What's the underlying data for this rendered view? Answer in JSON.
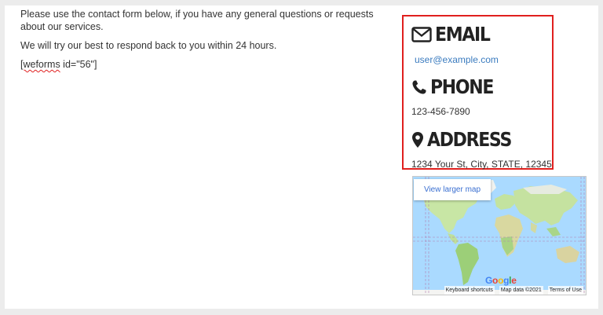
{
  "intro": {
    "line1": "Please use the contact form below, if you have any general questions or requests about our services.",
    "line2": "We will try our best to respond back to you within 24 hours.",
    "shortcode_word": "[weforms",
    "shortcode_rest": " id=\"56\"]"
  },
  "contact": {
    "email_title": "EMAIL",
    "email_value": "user@example.com",
    "phone_title": "PHONE",
    "phone_value": "123-456-7890",
    "address_title": "ADDRESS",
    "address_value": "1234 Your St, City, STATE, 12345",
    "highlight_color": "#e0201e"
  },
  "map": {
    "view_larger": "View larger map",
    "logo": "Google",
    "keyboard_shortcuts": "Keyboard shortcuts",
    "map_data": "Map data ©2021",
    "terms": "Terms of Use"
  },
  "icons": {
    "email": "envelope-icon",
    "phone": "phone-icon",
    "address": "map-marker-icon"
  }
}
